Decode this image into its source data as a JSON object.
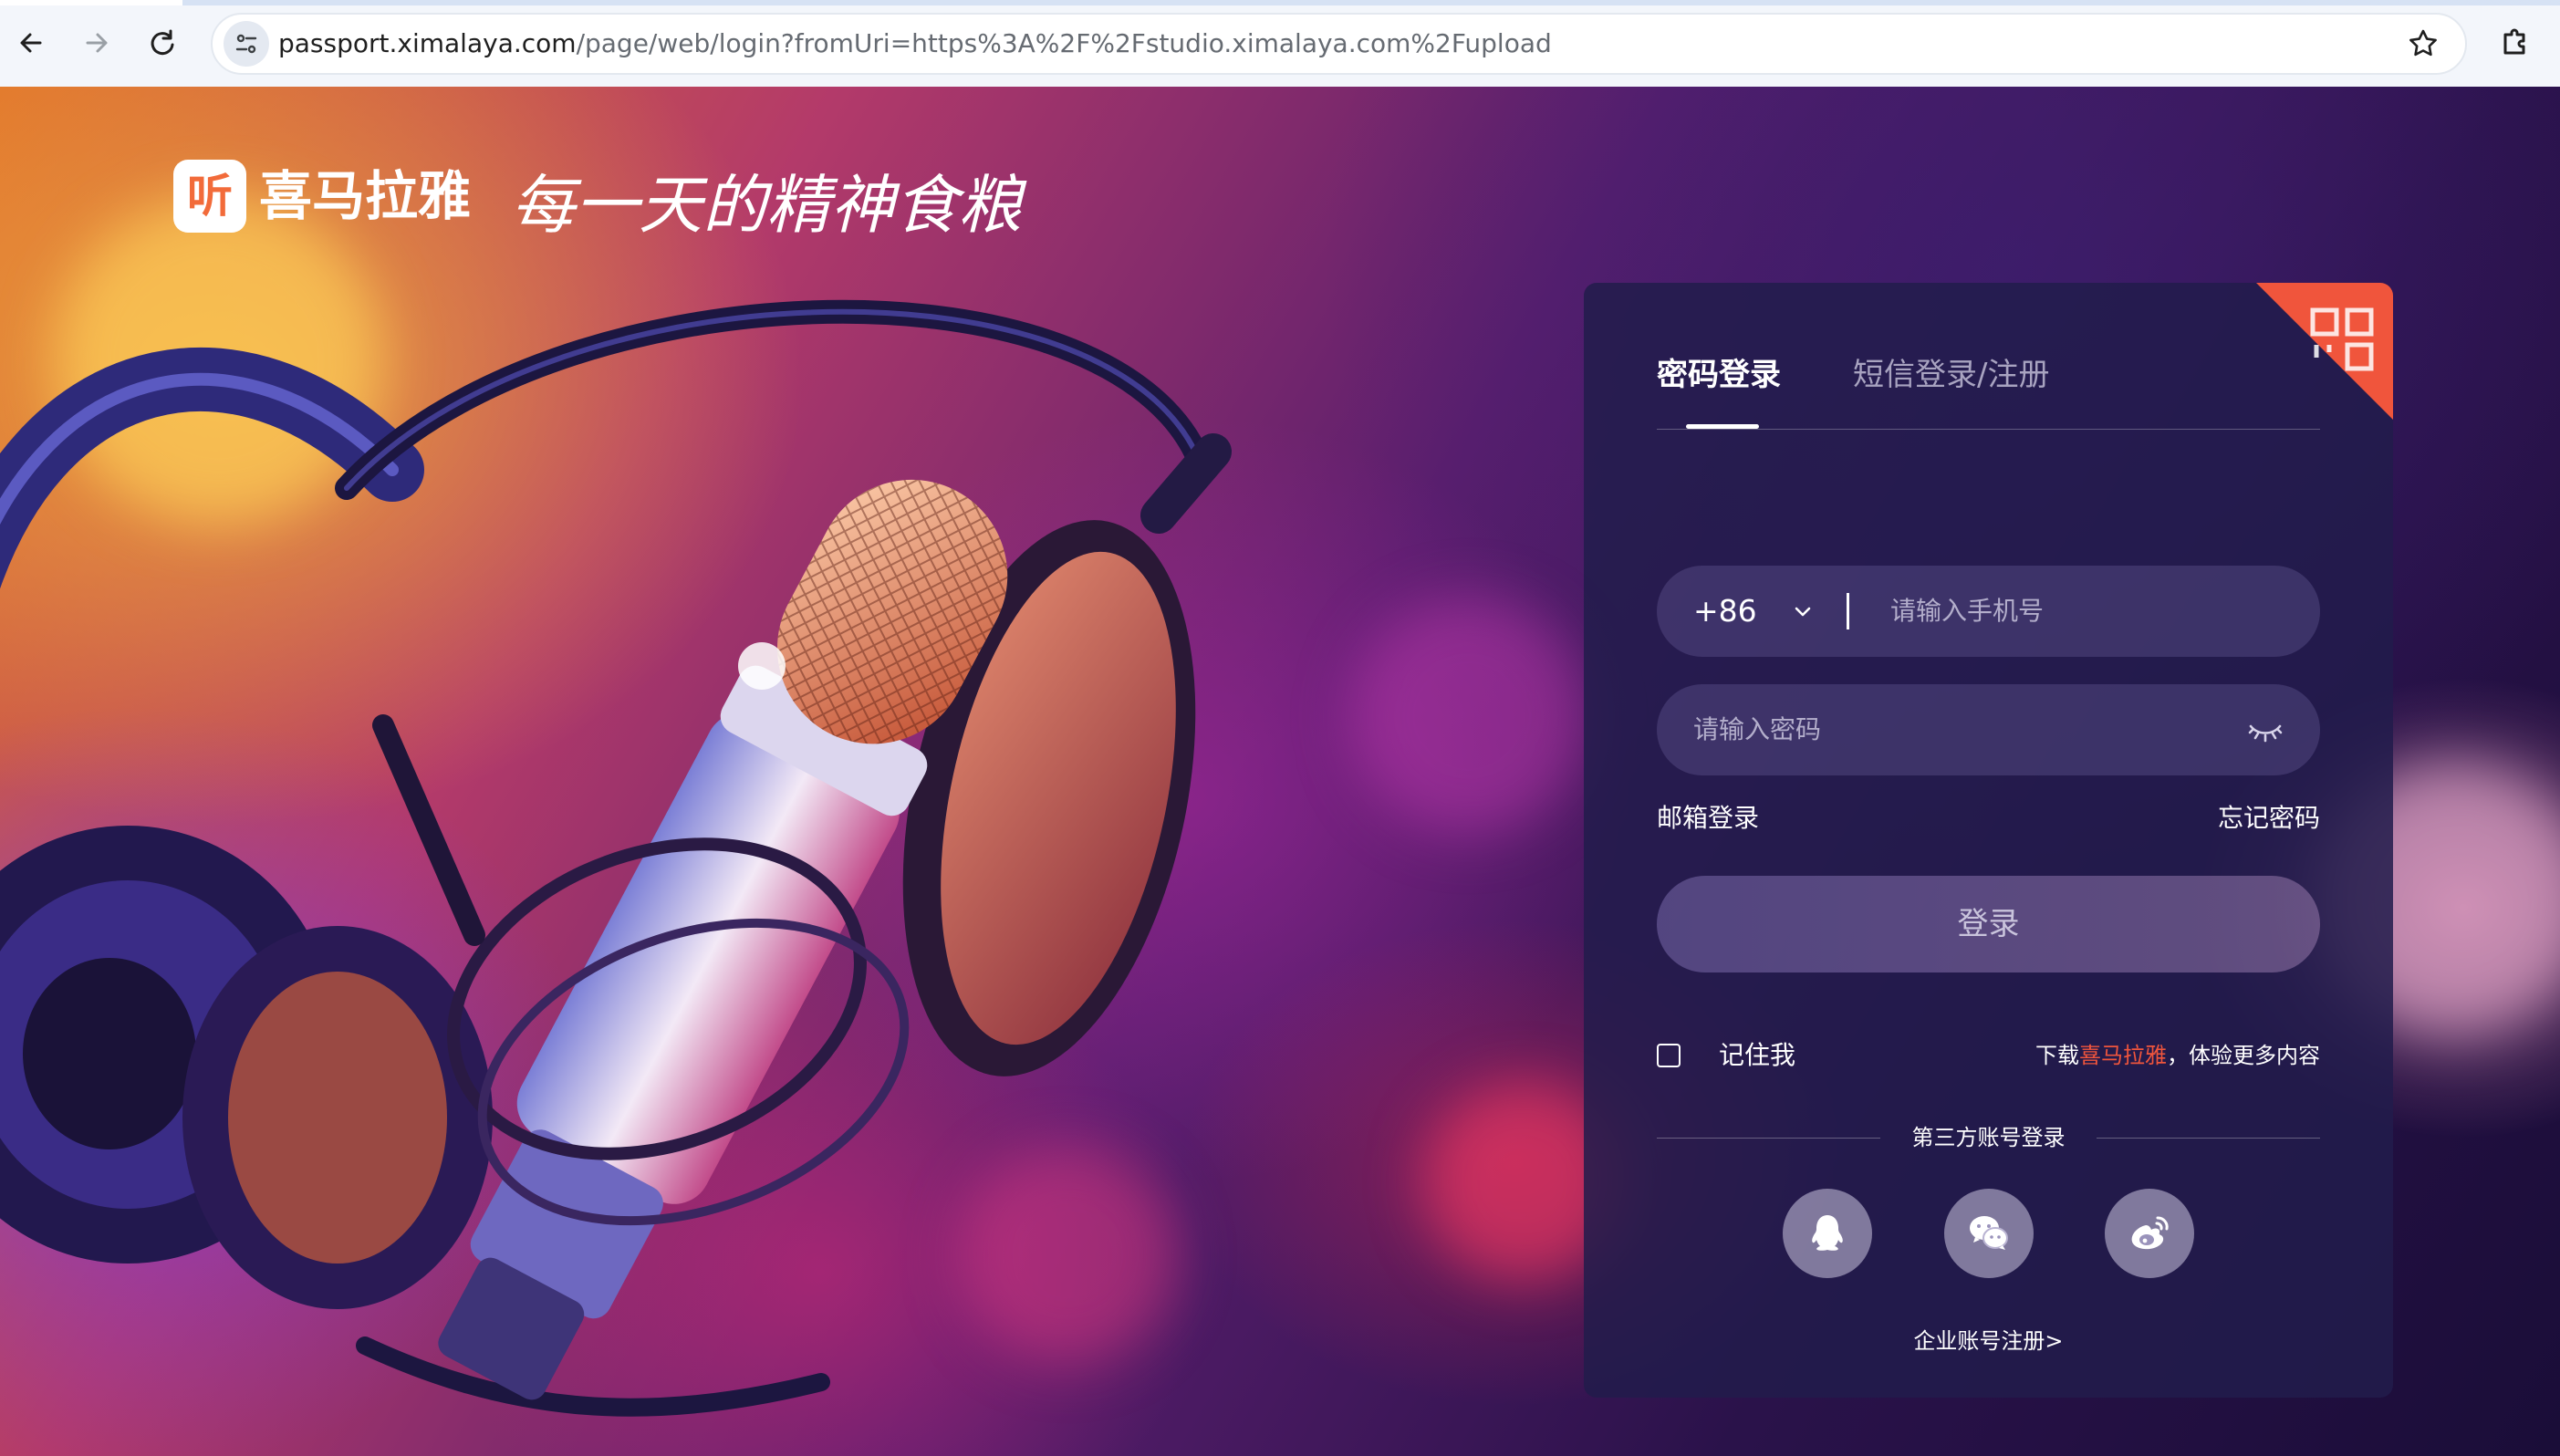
{
  "browser": {
    "url_host": "passport.ximalaya.com",
    "url_path": "/page/web/login?fromUri=https%3A%2F%2Fstudio.ximalaya.com%2Fupload",
    "icons": [
      "back-arrow-icon",
      "forward-arrow-icon",
      "reload-icon",
      "site-info-icon",
      "bookmark-star-icon",
      "extensions-icon"
    ]
  },
  "brand": {
    "logo_glyph": "听",
    "name": "喜马拉雅",
    "slogan": "每一天的精神食粮",
    "accent_color": "#f0553c"
  },
  "login": {
    "tabs": [
      {
        "label": "密码登录",
        "active": true
      },
      {
        "label": "短信登录/注册",
        "active": false
      }
    ],
    "country_code": "+86",
    "phone_placeholder": "请输入手机号",
    "password_placeholder": "请输入密码",
    "email_login": "邮箱登录",
    "forgot_password": "忘记密码",
    "submit": "登录",
    "remember_me": "记住我",
    "remember_checked": false,
    "download_prefix": "下载",
    "download_brand": "喜马拉雅",
    "download_suffix": "，体验更多内容",
    "third_party_label": "第三方账号登录",
    "third_party": [
      "qq-icon",
      "wechat-icon",
      "weibo-icon"
    ],
    "enterprise_register": "企业账号注册>"
  }
}
